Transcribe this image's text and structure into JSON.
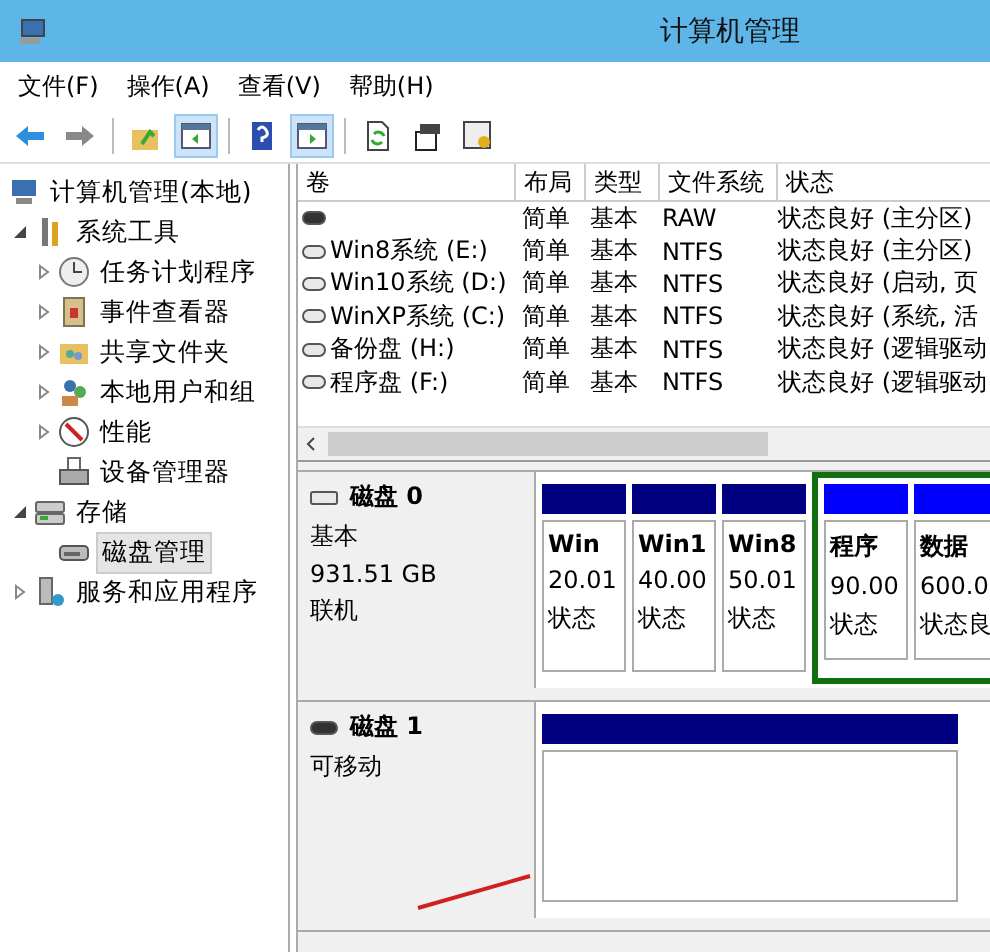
{
  "window": {
    "title": "计算机管理"
  },
  "menu": [
    "文件(F)",
    "操作(A)",
    "查看(V)",
    "帮助(H)"
  ],
  "toolbar": [
    {
      "kind": "back",
      "pressed": false
    },
    {
      "kind": "forward",
      "pressed": false
    },
    {
      "kind": "sep"
    },
    {
      "kind": "up",
      "pressed": false
    },
    {
      "kind": "tree",
      "pressed": true
    },
    {
      "kind": "sep"
    },
    {
      "kind": "help",
      "pressed": false
    },
    {
      "kind": "pane",
      "pressed": true
    },
    {
      "kind": "sep"
    },
    {
      "kind": "refresh",
      "pressed": false
    },
    {
      "kind": "props",
      "pressed": false
    },
    {
      "kind": "settings",
      "pressed": false
    }
  ],
  "tree": [
    {
      "label": "计算机管理(本地)",
      "selected": false,
      "children": [
        {
          "label": "系统工具",
          "expanded": true,
          "selected": false,
          "children": [
            {
              "label": "任务计划程序",
              "expanded": false,
              "selected": false
            },
            {
              "label": "事件查看器",
              "expanded": false,
              "selected": false
            },
            {
              "label": "共享文件夹",
              "expanded": false,
              "selected": false
            },
            {
              "label": "本地用户和组",
              "expanded": false,
              "selected": false
            },
            {
              "label": "性能",
              "expanded": false,
              "selected": false
            },
            {
              "label": "设备管理器",
              "selected": false
            }
          ]
        },
        {
          "label": "存储",
          "expanded": true,
          "selected": false,
          "children": [
            {
              "label": "磁盘管理",
              "selected": true
            }
          ]
        },
        {
          "label": "服务和应用程序",
          "expanded": false,
          "selected": false
        }
      ]
    }
  ],
  "volumes": {
    "columns": [
      "卷",
      "布局",
      "类型",
      "文件系统",
      "状态"
    ],
    "rows": [
      [
        "",
        "简单",
        "基本",
        "RAW",
        "状态良好 (主分区)"
      ],
      [
        "Win8系统 (E:)",
        "简单",
        "基本",
        "NTFS",
        "状态良好 (主分区)"
      ],
      [
        "Win10系统 (D:)",
        "简单",
        "基本",
        "NTFS",
        "状态良好 (启动, 页"
      ],
      [
        "WinXP系统 (C:)",
        "简单",
        "基本",
        "NTFS",
        "状态良好 (系统, 活"
      ],
      [
        "备份盘 (H:)",
        "简单",
        "基本",
        "NTFS",
        "状态良好 (逻辑驱动"
      ],
      [
        "程序盘 (F:)",
        "简单",
        "基本",
        "NTFS",
        "状态良好 (逻辑驱动"
      ]
    ]
  },
  "disks": [
    {
      "name": "磁盘 0",
      "lines": [
        "基本",
        "931.51 GB",
        "联机"
      ],
      "partitions": [
        {
          "kind": "primary",
          "name": "Win",
          "size": "20.01",
          "status": "状态"
        },
        {
          "kind": "primary",
          "name": "Win1",
          "size": "40.00",
          "status": "状态"
        },
        {
          "kind": "primary",
          "name": "Win8",
          "size": "50.01",
          "status": "状态"
        },
        {
          "kind": "logical",
          "name": "程序",
          "size": "90.00",
          "status": "状态"
        },
        {
          "kind": "logical",
          "name": "数据",
          "size": "600.0",
          "status": "状态良"
        }
      ]
    },
    {
      "name": "磁盘 1",
      "lines": [
        "可移动"
      ],
      "partitions": [
        {
          "kind": "empty"
        }
      ]
    }
  ]
}
